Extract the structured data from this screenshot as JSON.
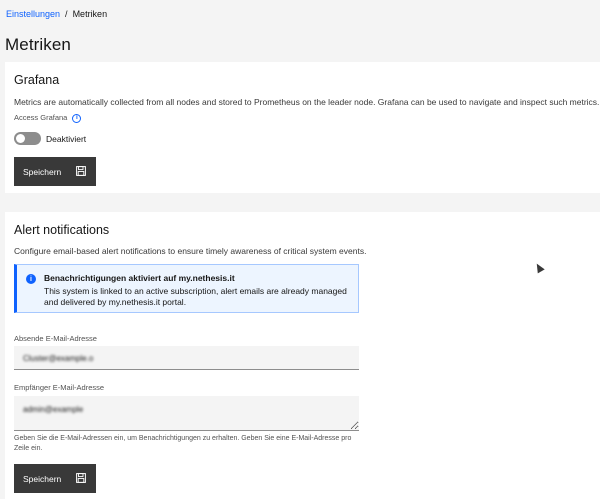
{
  "breadcrumb": {
    "parent": "Einstellungen",
    "separator": "/",
    "current": "Metriken"
  },
  "page": {
    "title": "Metriken"
  },
  "grafana": {
    "title": "Grafana",
    "description": "Metrics are automatically collected from all nodes and stored to Prometheus on the leader node. Grafana can be used to navigate and inspect such metrics.",
    "access_label": "Access Grafana",
    "toggle_state": "Deaktiviert",
    "toggle_on": false,
    "save_label": "Speichern"
  },
  "alerts": {
    "title": "Alert notifications",
    "description": "Configure email-based alert notifications to ensure timely awareness of critical system events.",
    "notification": {
      "title": "Benachrichtigungen aktiviert auf my.nethesis.it",
      "body": "This system is linked to an active subscription, alert emails are already managed and delivered by my.nethesis.it portal."
    },
    "sender_label": "Absende E-Mail-Adresse",
    "sender_value": "Cluster@example.o",
    "recipients_label": "Empfänger E-Mail-Adresse",
    "recipients_value": "admin@example",
    "helper": "Geben Sie die E-Mail-Adressen ein, um Benachrichtigungen zu erhalten. Geben Sie eine E-Mail-Adresse pro Zeile ein.",
    "save_label": "Speichern"
  },
  "colors": {
    "link": "#0f62fe",
    "button_bg": "#393939",
    "notification_bg": "#edf5ff",
    "page_bg": "#f4f4f4"
  },
  "icons": {
    "info": "info-icon",
    "save": "floppy-disk-icon",
    "notification": "info-filled-icon",
    "cursor": "mouse-pointer-icon"
  }
}
